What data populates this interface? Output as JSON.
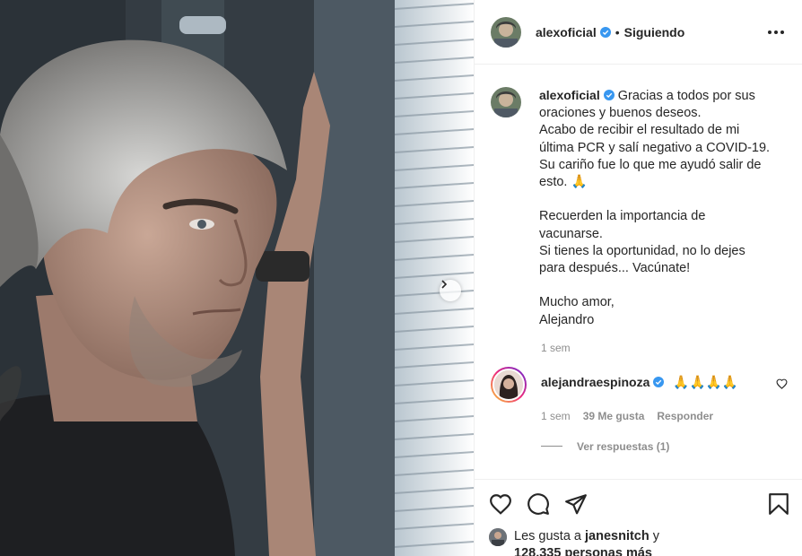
{
  "post": {
    "username": "alexoficial",
    "dot": "•",
    "follow_status": "Siguiendo",
    "caption_lines": [
      "Gracias a todos por sus",
      "oraciones y buenos deseos.",
      "Acabo de recibir el resultado de mi",
      "última PCR y salí negativo a COVID-19.",
      "Su cariño fue lo que me ayudó salir de",
      "esto. 🙏",
      "",
      "Recuerden la importancia de",
      "vacunarse.",
      "Si tienes la oportunidad, no lo dejes",
      "para después... Vacúnate!",
      "",
      "Mucho amor,",
      "Alejandro"
    ],
    "caption_time": "1 sem"
  },
  "comment": {
    "username": "alejandraespinoza",
    "text": "🙏🙏🙏🙏",
    "time": "1 sem",
    "likes": "39 Me gusta",
    "reply_label": "Responder",
    "view_replies": "Ver respuestas (1)"
  },
  "likes": {
    "prefix": "Les gusta a",
    "user": "janesnitch",
    "conj": "y",
    "count": "128,335 personas más"
  },
  "colors": {
    "verified": "#3897f0",
    "text": "#262626",
    "muted": "#8e8e8e",
    "border": "#efefef"
  }
}
